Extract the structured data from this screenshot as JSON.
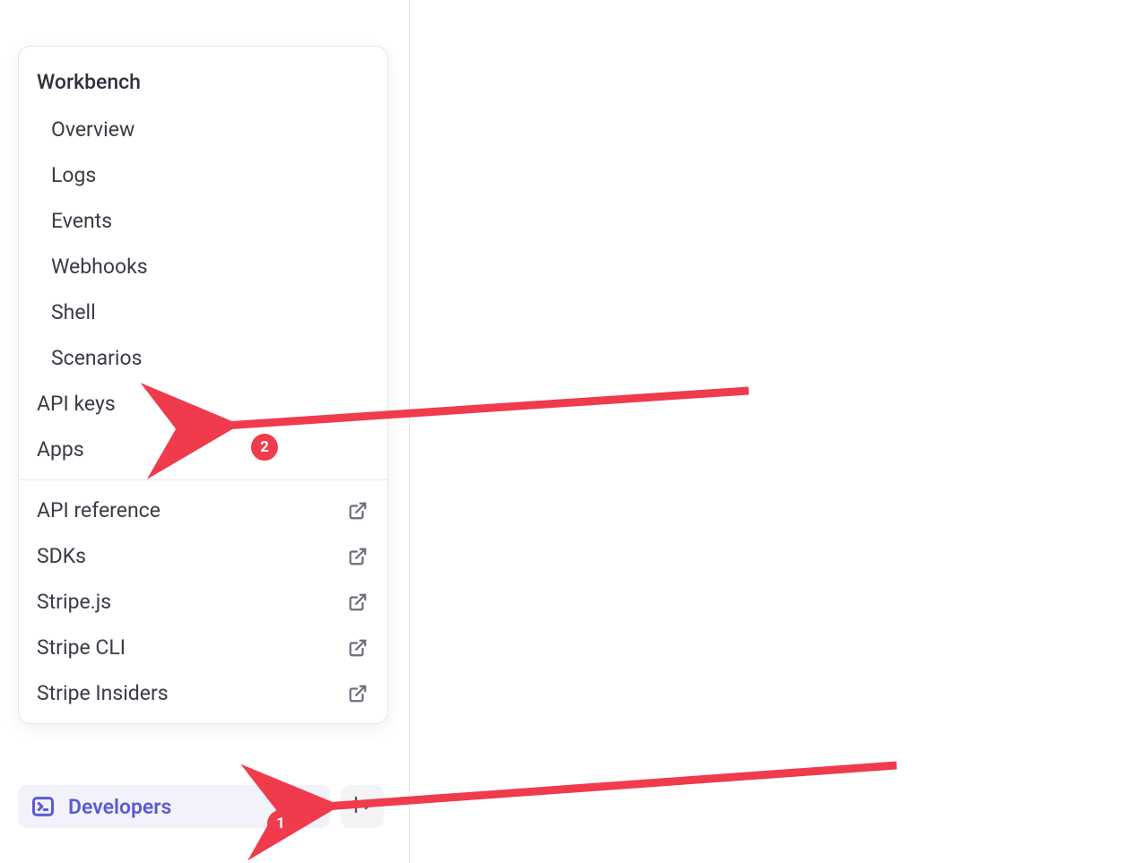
{
  "popup": {
    "section1": {
      "header": "Workbench",
      "items": [
        "Overview",
        "Logs",
        "Events",
        "Webhooks",
        "Shell",
        "Scenarios"
      ]
    },
    "section2": {
      "items": [
        "API keys",
        "Apps"
      ]
    },
    "section3": {
      "items": [
        "API reference",
        "SDKs",
        "Stripe.js",
        "Stripe CLI",
        "Stripe Insiders"
      ]
    }
  },
  "bottombar": {
    "developers_label": "Developers"
  },
  "annotations": {
    "arrow1_badge": "1",
    "arrow2_badge": "2"
  }
}
